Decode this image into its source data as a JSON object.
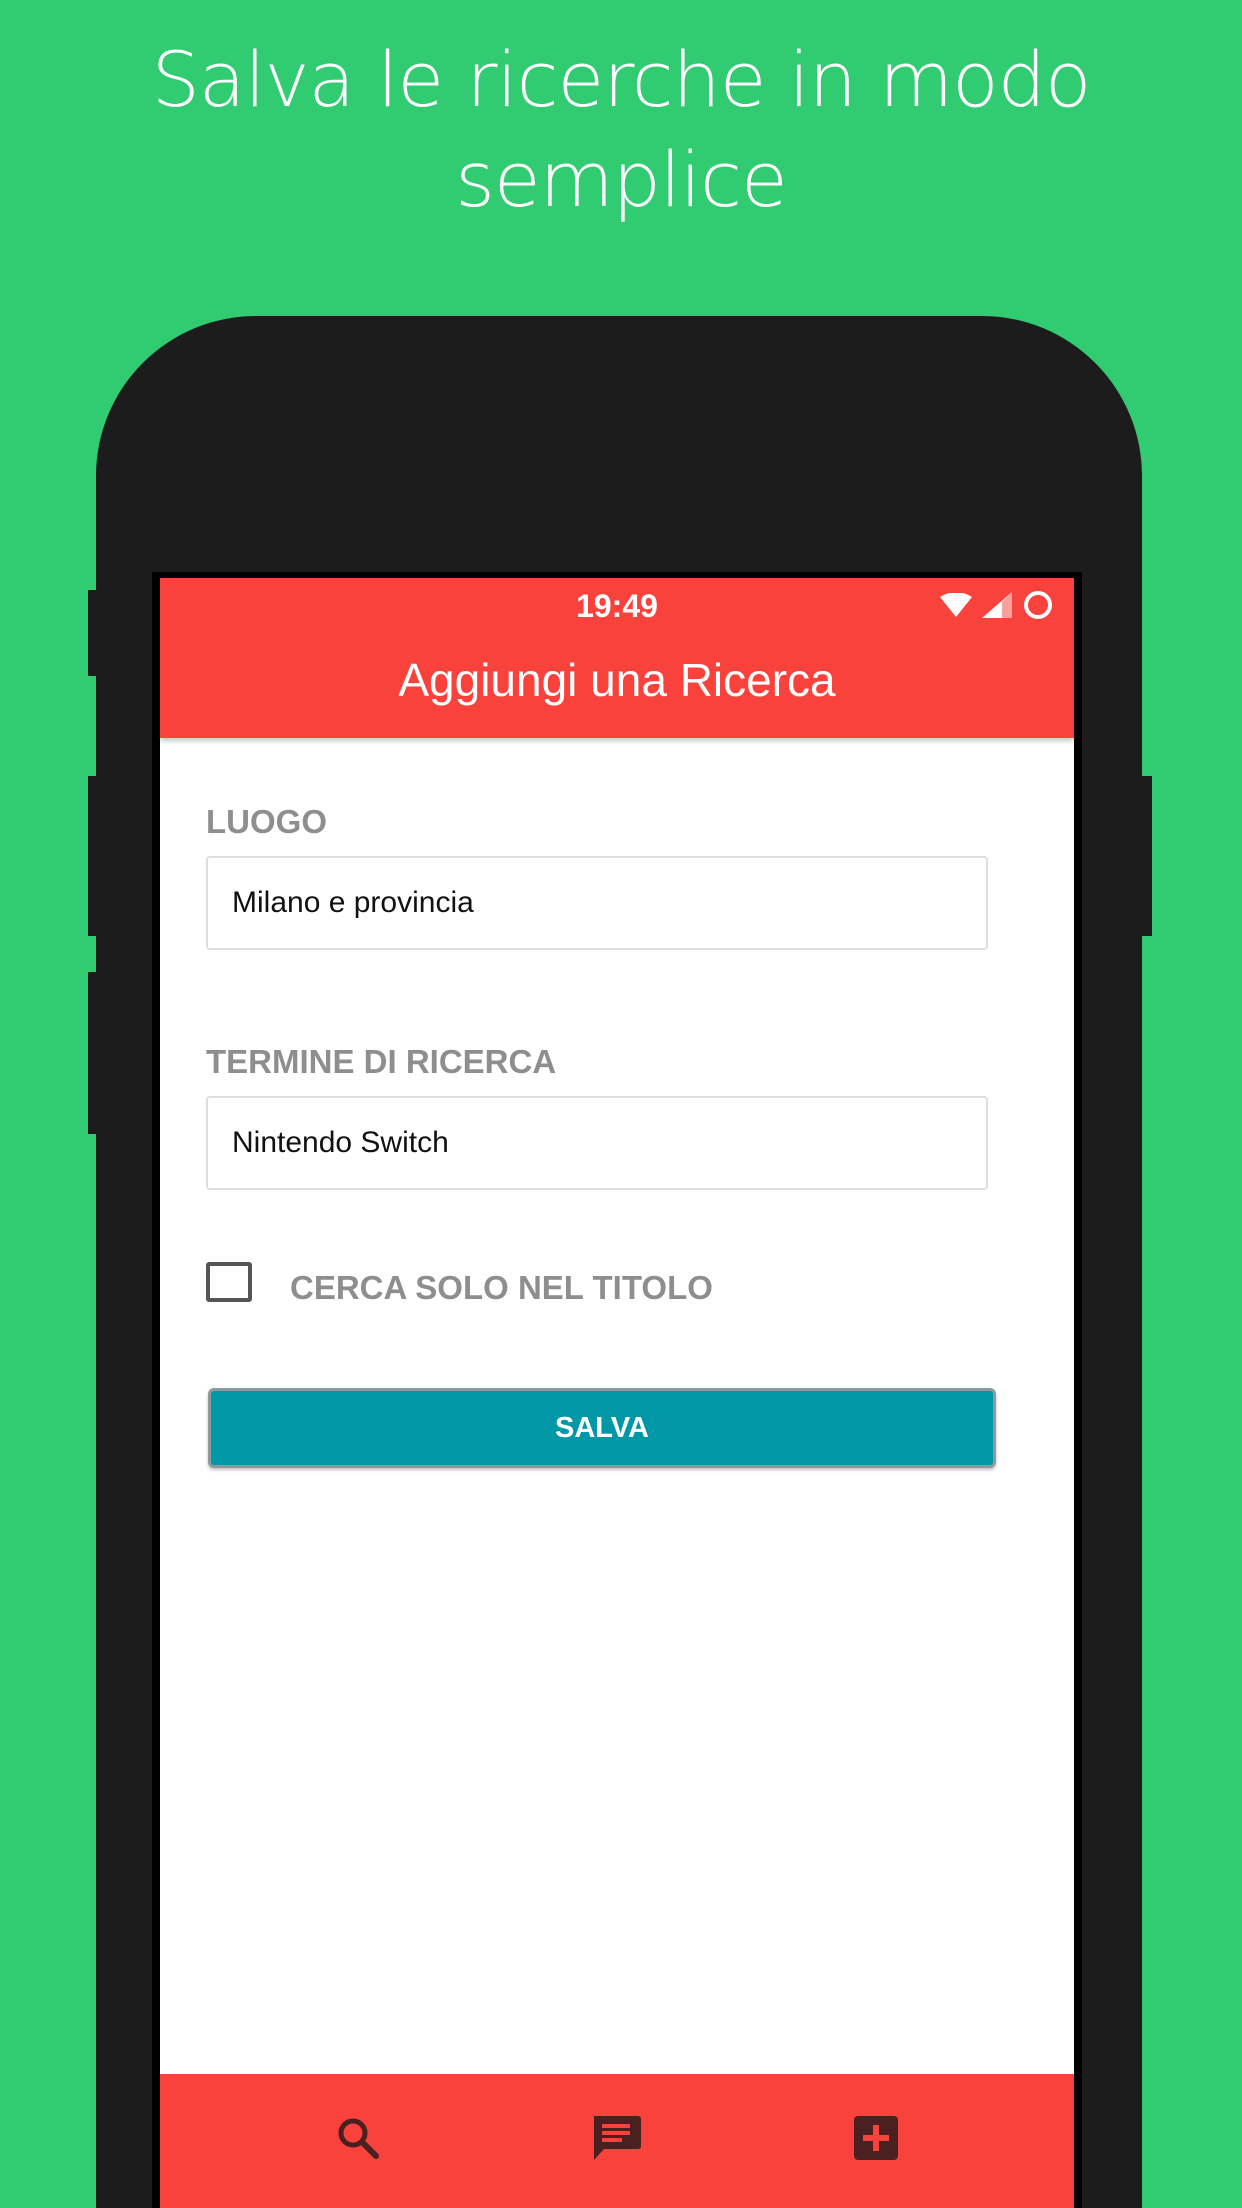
{
  "headline": "Salva le ricerche in modo semplice",
  "status_bar": {
    "time": "19:49",
    "icons": [
      "wifi-icon",
      "cellular-signal-icon",
      "battery-ring-icon"
    ]
  },
  "app_bar": {
    "title": "Aggiungi una Ricerca"
  },
  "form": {
    "location_label": "LUOGO",
    "location_value": "Milano e provincia",
    "term_label": "TERMINE DI RICERCA",
    "term_value": "Nintendo Switch",
    "title_only_label": "CERCA SOLO NEL TITOLO",
    "title_only_checked": false,
    "save_label": "SALVA"
  },
  "bottom_nav": {
    "items": [
      "search-icon",
      "message-icon",
      "add-box-icon"
    ]
  },
  "colors": {
    "background": "#31cb72",
    "accent_red": "#f9423b",
    "button_teal": "#0098a7",
    "label_gray": "#8e8e8e",
    "phone_body": "#1c1c1c",
    "nav_icon": "#4a2020"
  }
}
